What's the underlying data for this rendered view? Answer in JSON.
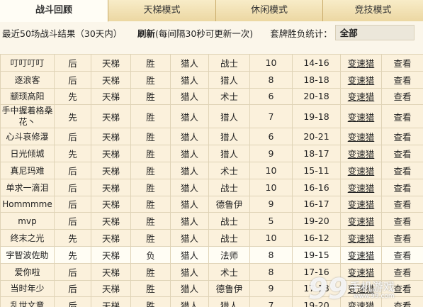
{
  "tabs": [
    "战斗回顾",
    "天梯模式",
    "休闲模式",
    "竞技模式"
  ],
  "toolbar": {
    "summary": "最近50场战斗结果（30天内）",
    "refresh_label": "刷新",
    "refresh_note": "(每间隔30秒可更新一次)",
    "stat_label": "套牌胜负统计：",
    "stat_value": "全部"
  },
  "rows": [
    [
      "叮叮叮叮",
      "后",
      "天梯",
      "胜",
      "猎人",
      "战士",
      "10",
      "14-16",
      "变速猎",
      "查看"
    ],
    [
      "逐浪客",
      "后",
      "天梯",
      "胜",
      "猎人",
      "猎人",
      "8",
      "18-18",
      "变速猎",
      "查看"
    ],
    [
      "颛顼高阳",
      "先",
      "天梯",
      "胜",
      "猎人",
      "术士",
      "6",
      "20-18",
      "变速猎",
      "查看"
    ],
    [
      "手中握着格桑花丶",
      "先",
      "天梯",
      "胜",
      "猎人",
      "猎人",
      "7",
      "19-18",
      "变速猎",
      "查看"
    ],
    [
      "心斗哀修瀑",
      "后",
      "天梯",
      "胜",
      "猎人",
      "猎人",
      "6",
      "20-21",
      "变速猎",
      "查看"
    ],
    [
      "日光倾城",
      "先",
      "天梯",
      "胜",
      "猎人",
      "猎人",
      "9",
      "18-17",
      "变速猎",
      "查看"
    ],
    [
      "真尼玛难",
      "后",
      "天梯",
      "胜",
      "猎人",
      "术士",
      "10",
      "15-11",
      "变速猎",
      "查看"
    ],
    [
      "单求一滴泪",
      "后",
      "天梯",
      "胜",
      "猎人",
      "战士",
      "10",
      "16-16",
      "变速猎",
      "查看"
    ],
    [
      "Hommmme",
      "后",
      "天梯",
      "胜",
      "猎人",
      "德鲁伊",
      "9",
      "16-17",
      "变速猎",
      "查看"
    ],
    [
      "mvp",
      "后",
      "天梯",
      "胜",
      "猎人",
      "战士",
      "5",
      "19-20",
      "变速猎",
      "查看"
    ],
    [
      "终末之光",
      "先",
      "天梯",
      "胜",
      "猎人",
      "战士",
      "10",
      "16-12",
      "变速猎",
      "查看"
    ],
    [
      "宇智波佐助",
      "先",
      "天梯",
      "负",
      "猎人",
      "法师",
      "8",
      "19-15",
      "变速猎",
      "查看"
    ],
    [
      "爱你啦",
      "后",
      "天梯",
      "胜",
      "猎人",
      "术士",
      "8",
      "17-16",
      "变速猎",
      "查看"
    ],
    [
      "当时年少",
      "后",
      "天梯",
      "胜",
      "猎人",
      "德鲁伊",
      "9",
      "17-18",
      "变速猎",
      "查看"
    ],
    [
      "乱世文意",
      "后",
      "天梯",
      "胜",
      "猎人",
      "猎人",
      "7",
      "19-20",
      "变速猎",
      "查看"
    ]
  ],
  "watermark": {
    "num": "99",
    "text": "手机游戏",
    "url": "www.99.com"
  }
}
